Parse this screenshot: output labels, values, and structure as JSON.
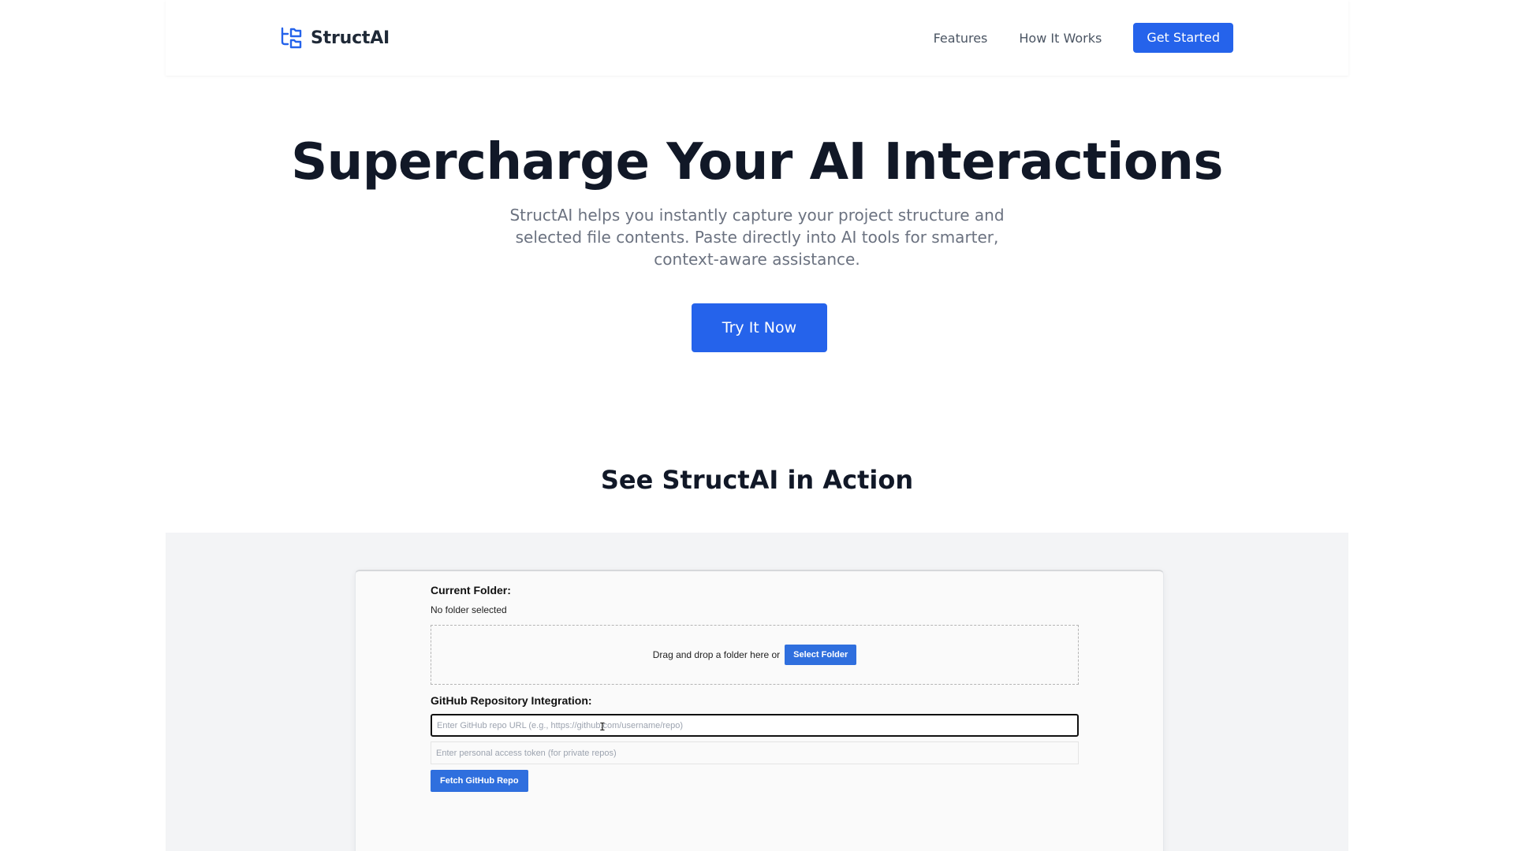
{
  "header": {
    "brand": "StructAI",
    "nav": [
      {
        "label": "Features"
      },
      {
        "label": "How It Works"
      }
    ],
    "cta_label": "Get Started"
  },
  "hero": {
    "title": "Supercharge Your AI Interactions",
    "subtitle": "StructAI helps you instantly capture your project structure and selected file contents. Paste directly into AI tools for smarter, context-aware assistance.",
    "cta_label": "Try It Now"
  },
  "demo": {
    "heading": "See StructAI in Action",
    "app": {
      "current_folder_label": "Current Folder:",
      "current_folder_value": "No folder selected",
      "dropzone_text": "Drag and drop a folder here or",
      "select_folder_label": "Select Folder",
      "github_label": "GitHub Repository Integration:",
      "repo_url_placeholder": "Enter GitHub repo URL (e.g., https://github.com/username/repo)",
      "token_placeholder": "Enter personal access token (for private repos)",
      "fetch_label": "Fetch GitHub Repo"
    }
  },
  "colors": {
    "primary": "#2563eb",
    "heading": "#111827",
    "muted": "#6b7280",
    "demo_background": "#f3f4f6"
  },
  "icons": {
    "brand": "folder-tree-icon"
  }
}
